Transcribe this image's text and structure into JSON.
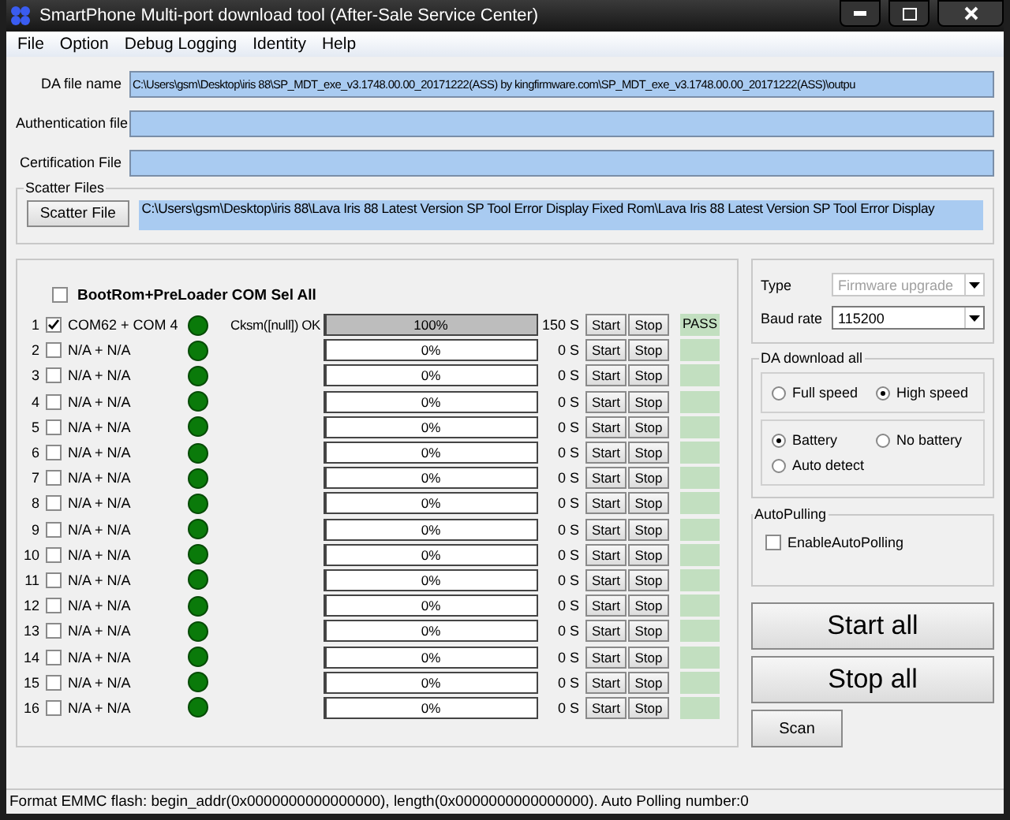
{
  "window": {
    "title": "SmartPhone Multi-port download tool (After-Sale Service Center)"
  },
  "menu": [
    "File",
    "Option",
    "Debug Logging",
    "Identity",
    "Help"
  ],
  "files": [
    {
      "label": "DA file name",
      "value": "C:\\Users\\gsm\\Desktop\\iris 88\\SP_MDT_exe_v3.1748.00.00_20171222(ASS) by kingfirmware.com\\SP_MDT_exe_v3.1748.00.00_20171222(ASS)\\outpu"
    },
    {
      "label": "Authentication file"
    },
    {
      "label": "Certification File"
    }
  ],
  "scatter": {
    "group": "Scatter Files",
    "button": "Scatter File",
    "value": "C:\\Users\\gsm\\Desktop\\iris 88\\Lava Iris 88 Latest Version SP Tool Error Display Fixed Rom\\Lava Iris 88 Latest Version SP Tool Error Display"
  },
  "select_all": {
    "label": "BootRom+PreLoader COM Sel All",
    "checked": false
  },
  "ports": [
    {
      "index": "1",
      "checked": true,
      "port": "COM62 + COM 4",
      "status": "Cksm([null]) OK",
      "level": 1,
      "percent": "100%",
      "time": "150 S",
      "result": "PASS"
    },
    {
      "index": "2",
      "checked": false,
      "port": "N/A + N/A",
      "level": 0,
      "percent": "0%",
      "time": "0 S"
    },
    {
      "index": "3",
      "checked": false,
      "port": "N/A + N/A",
      "level": 0,
      "percent": "0%",
      "time": "0 S"
    },
    {
      "index": "4",
      "checked": false,
      "port": "N/A + N/A",
      "level": 0,
      "percent": "0%",
      "time": "0 S"
    },
    {
      "index": "5",
      "checked": false,
      "port": "N/A + N/A",
      "level": 0,
      "percent": "0%",
      "time": "0 S"
    },
    {
      "index": "6",
      "checked": false,
      "port": "N/A + N/A",
      "level": 0,
      "percent": "0%",
      "time": "0 S"
    },
    {
      "index": "7",
      "checked": false,
      "port": "N/A + N/A",
      "level": 0,
      "percent": "0%",
      "time": "0 S"
    },
    {
      "index": "8",
      "checked": false,
      "port": "N/A + N/A",
      "level": 0,
      "percent": "0%",
      "time": "0 S"
    },
    {
      "index": "9",
      "checked": false,
      "port": "N/A + N/A",
      "level": 0,
      "percent": "0%",
      "time": "0 S"
    },
    {
      "index": "10",
      "checked": false,
      "port": "N/A + N/A",
      "level": 0,
      "percent": "0%",
      "time": "0 S"
    },
    {
      "index": "11",
      "checked": false,
      "port": "N/A + N/A",
      "level": 0,
      "percent": "0%",
      "time": "0 S"
    },
    {
      "index": "12",
      "checked": false,
      "port": "N/A + N/A",
      "level": 0,
      "percent": "0%",
      "time": "0 S"
    },
    {
      "index": "13",
      "checked": false,
      "port": "N/A + N/A",
      "level": 0,
      "percent": "0%",
      "time": "0 S"
    },
    {
      "index": "14",
      "checked": false,
      "port": "N/A + N/A",
      "level": 0,
      "percent": "0%",
      "time": "0 S"
    },
    {
      "index": "15",
      "checked": false,
      "port": "N/A + N/A",
      "level": 0,
      "percent": "0%",
      "time": "0 S"
    },
    {
      "index": "16",
      "checked": false,
      "port": "N/A + N/A",
      "level": 0,
      "percent": "0%",
      "time": "0 S"
    }
  ],
  "port_buttons": [
    {
      "start": "Start",
      "stop": "Stop"
    },
    {
      "start": "Start",
      "stop": "Stop"
    },
    {
      "start": "Start",
      "stop": "Stop"
    },
    {
      "start": "Start",
      "stop": "Stop"
    },
    {
      "start": "Start",
      "stop": "Stop"
    },
    {
      "start": "Start",
      "stop": "Stop"
    },
    {
      "start": "Start",
      "stop": "Stop"
    },
    {
      "start": "Start",
      "stop": "Stop"
    },
    {
      "start": "Start",
      "stop": "Stop"
    },
    {
      "start": "Start",
      "stop": "Stop"
    },
    {
      "start": "Start",
      "stop": "Stop"
    },
    {
      "start": "Start",
      "stop": "Stop"
    },
    {
      "start": "Start",
      "stop": "Stop"
    },
    {
      "start": "Start",
      "stop": "Stop"
    },
    {
      "start": "Start",
      "stop": "Stop"
    },
    {
      "start": "Start",
      "stop": "Stop"
    }
  ],
  "type": {
    "label": "Type",
    "value": "Firmware upgrade",
    "disabled": true
  },
  "baud": {
    "label": "Baud rate",
    "value": "115200",
    "disabled": false
  },
  "da_download": {
    "group": "DA download all",
    "speed": [
      {
        "label": "Full speed",
        "selected": false
      },
      {
        "label": "High speed",
        "selected": true
      }
    ],
    "battery": [
      {
        "label": "Battery",
        "selected": true
      },
      {
        "label": "No battery",
        "selected": false
      },
      {
        "label": "Auto detect",
        "selected": false
      }
    ]
  },
  "auto_polling": {
    "group": "AutoPulling",
    "label": "EnableAutoPolling",
    "checked": false
  },
  "start_all": "Start all",
  "stop_all": "Stop all",
  "scan": "Scan",
  "status_bar": "Format EMMC flash:  begin_addr(0x0000000000000000), length(0x0000000000000000). Auto Polling number:0"
}
